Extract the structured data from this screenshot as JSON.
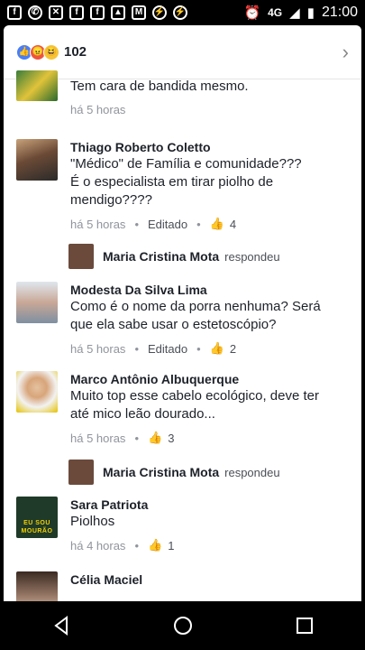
{
  "status_bar": {
    "network": "4G",
    "time": "21:00",
    "left_icons": [
      "facebook-notification-icon",
      "whatsapp-icon",
      "phone-missed-icon",
      "facebook-notification-icon",
      "facebook-notification-icon",
      "image-icon",
      "gmail-icon",
      "messenger-icon",
      "messenger-icon"
    ]
  },
  "header": {
    "reaction_count": "102",
    "reactions": [
      "like",
      "angry",
      "haha"
    ]
  },
  "comments": [
    {
      "author": "",
      "text": "Tem cara de bandida mesmo.",
      "time": "há 5 horas",
      "edited": "",
      "likes": ""
    },
    {
      "author": "Thiago Roberto Coletto",
      "text": "\"Médico\" de Família e comunidade???\nÉ o especialista em tirar piolho de mendigo????",
      "time": "há 5 horas",
      "edited": "Editado",
      "likes": "4"
    },
    {
      "author": "Modesta Da Silva Lima",
      "text": "Como é o nome da porra nenhuma? Será que ela sabe usar o estetoscópio?",
      "time": "há 5 horas",
      "edited": "Editado",
      "likes": "2"
    },
    {
      "author": "Marco Antônio Albuquerque",
      "text": "Muito top esse cabelo ecológico, deve ter até mico leão dourado...",
      "time": "há 5 horas",
      "edited": "",
      "likes": "3"
    },
    {
      "author": "Sara Patriota",
      "text": "Piolhos",
      "time": "há 4 horas",
      "edited": "",
      "likes": "1"
    },
    {
      "author": "Célia Maciel",
      "text": "",
      "time": "",
      "edited": "",
      "likes": ""
    }
  ],
  "replies": [
    {
      "name": "Maria Cristina Mota",
      "verb": "respondeu"
    },
    {
      "name": "Maria Cristina Mota",
      "verb": "respondeu"
    }
  ],
  "avatar_texts": {
    "sara": "EU SOU MOURÃO"
  }
}
